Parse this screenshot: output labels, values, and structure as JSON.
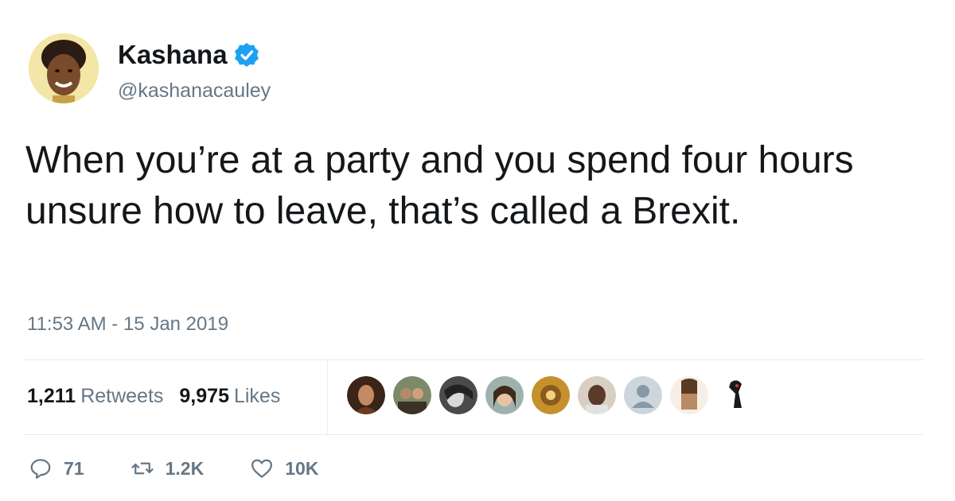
{
  "author": {
    "name": "Kashana",
    "handle": "@kashanacauley",
    "verified": true
  },
  "tweet": {
    "text": "When you’re at a party and you spend four hours unsure how to leave, that’s called a Brexit.",
    "timestamp": "11:53 AM - 15 Jan 2019"
  },
  "stats": {
    "retweets_count": "1,211",
    "retweets_label": "Retweets",
    "likes_count": "9,975",
    "likes_label": "Likes"
  },
  "actions": {
    "reply_count": "71",
    "retweet_count": "1.2K",
    "like_count": "10K"
  },
  "colors": {
    "verified_blue": "#1da1f2",
    "muted_text": "#657786",
    "divider": "#e6ecf0"
  },
  "likers": [
    {
      "icon": "avatar-photo",
      "tone": "#8a5a3c"
    },
    {
      "icon": "avatar-photo",
      "tone": "#7b6a4e"
    },
    {
      "icon": "avatar-photo",
      "tone": "#6f6f6f"
    },
    {
      "icon": "avatar-photo",
      "tone": "#9aa6a2"
    },
    {
      "icon": "avatar-photo",
      "tone": "#a87b2a"
    },
    {
      "icon": "avatar-photo",
      "tone": "#5e4a3a"
    },
    {
      "icon": "default-avatar",
      "tone": "#ccd6dd"
    },
    {
      "icon": "avatar-photo",
      "tone": "#b08a6a"
    },
    {
      "icon": "avatar-drawing",
      "tone": "#222222"
    }
  ]
}
